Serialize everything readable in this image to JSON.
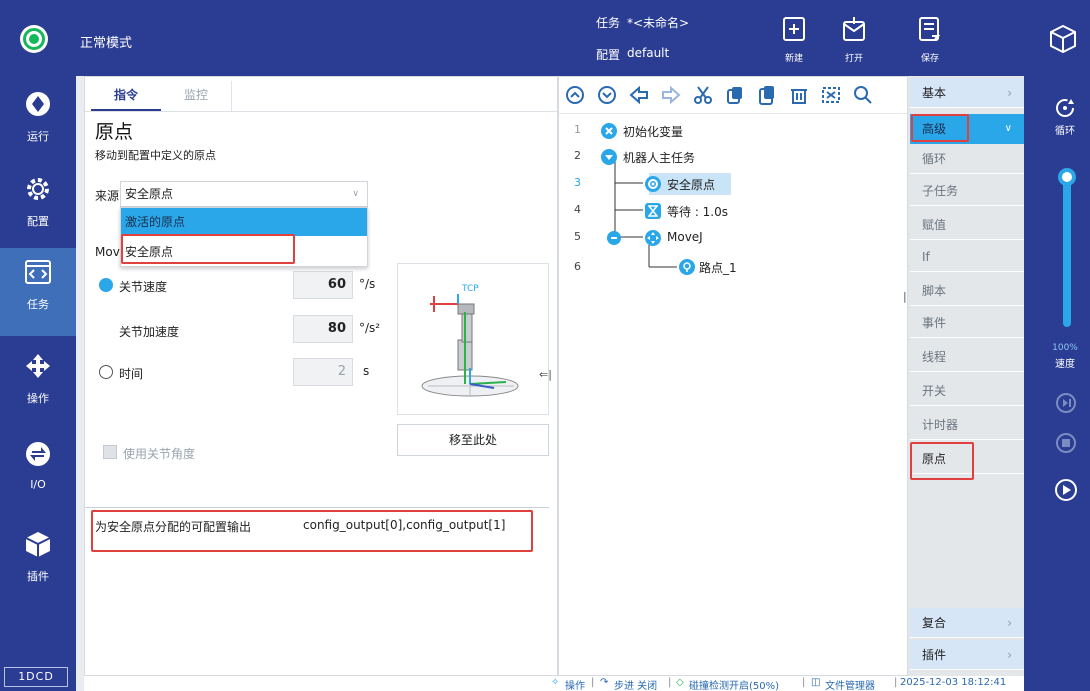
{
  "topbar": {
    "mode": "正常模式",
    "task_label": "任务",
    "task_value": "*<未命名>",
    "config_label": "配置",
    "config_value": "default",
    "buttons": {
      "new": "新建",
      "open": "打开",
      "save": "保存"
    }
  },
  "nav": {
    "run": "运行",
    "config": "配置",
    "task": "任务",
    "operate": "操作",
    "io": "I/O",
    "plugin": "插件"
  },
  "version": "1DCD",
  "left_panel": {
    "tabs": {
      "command": "指令",
      "monitor": "监控"
    },
    "title": "原点",
    "description": "移动到配置中定义的原点",
    "source_label": "来源",
    "source_value": "安全原点",
    "dropdown_options": [
      "激活的原点",
      "安全原点"
    ],
    "move_label_partial": "Mov",
    "joint_speed": {
      "label": "关节速度",
      "value": "60",
      "unit": "°/s",
      "selected": true
    },
    "joint_accel": {
      "label": "关节加速度",
      "value": "80",
      "unit": "°/s²"
    },
    "time": {
      "label": "时间",
      "value": "2",
      "unit": "s",
      "selected": false
    },
    "tcp_label": "TCP",
    "move_here_button": "移至此处",
    "use_joint_angles": "使用关节角度",
    "output_label": "为安全原点分配的可配置输出",
    "output_value": "config_output[0],config_output[1]"
  },
  "tree": {
    "rows": [
      {
        "line": "1",
        "label": "初始化变量"
      },
      {
        "line": "2",
        "label": "机器人主任务"
      },
      {
        "line": "3",
        "label": "安全原点"
      },
      {
        "line": "4",
        "label": "等待 : 1.0s"
      },
      {
        "line": "5",
        "label": "MoveJ"
      },
      {
        "line": "6",
        "label": "路点_1"
      }
    ]
  },
  "categories": {
    "basic": "基本",
    "advanced": "高级",
    "items": [
      "循环",
      "子任务",
      "赋值",
      "If",
      "脚本",
      "事件",
      "线程",
      "开关",
      "计时器",
      "原点"
    ],
    "composite": "复合",
    "plugin": "插件"
  },
  "right_bar": {
    "loop": "循环",
    "speed_pct": "100%",
    "speed_label": "速度",
    "speed_level": 1.0
  },
  "status": {
    "operate": "操作",
    "step": "步进 关闭",
    "collision": "碰撞检测开启(50%)",
    "file_manager": "文件管理器",
    "datetime": "2025-12-03 18:12:41"
  },
  "colors": {
    "primary": "#2a3d92",
    "accent": "#2aa7e8",
    "highlight_border": "#e04040",
    "mode_green": "#14b85a"
  }
}
